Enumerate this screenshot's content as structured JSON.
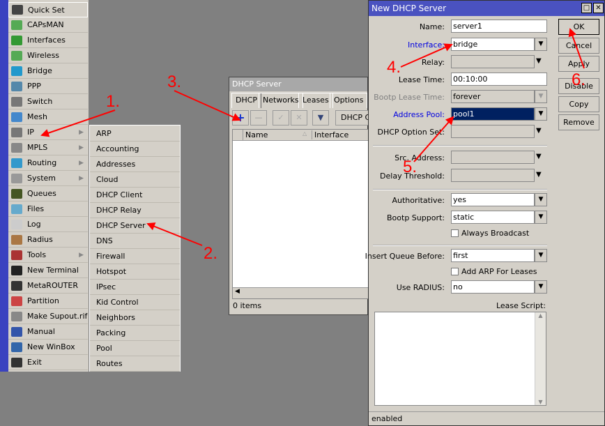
{
  "menu": {
    "items": [
      {
        "label": "Quick Set",
        "icon": "wand-icon",
        "color": "#444"
      },
      {
        "label": "CAPsMAN",
        "icon": "antenna-icon",
        "color": "#5a5"
      },
      {
        "label": "Interfaces",
        "icon": "nic-icon",
        "color": "#393"
      },
      {
        "label": "Wireless",
        "icon": "antenna-icon",
        "color": "#5a5"
      },
      {
        "label": "Bridge",
        "icon": "bridge-icon",
        "color": "#29c"
      },
      {
        "label": "PPP",
        "icon": "ppp-icon",
        "color": "#58a"
      },
      {
        "label": "Switch",
        "icon": "switch-icon",
        "color": "#777"
      },
      {
        "label": "Mesh",
        "icon": "mesh-icon",
        "color": "#48c"
      },
      {
        "label": "IP",
        "icon": "ip-icon",
        "color": "#777",
        "submenu": true
      },
      {
        "label": "MPLS",
        "icon": "mpls-icon",
        "color": "#888",
        "submenu": true
      },
      {
        "label": "Routing",
        "icon": "routing-icon",
        "color": "#39c",
        "submenu": true
      },
      {
        "label": "System",
        "icon": "gear-icon",
        "color": "#999",
        "submenu": true
      },
      {
        "label": "Queues",
        "icon": "queues-icon",
        "color": "#452"
      },
      {
        "label": "Files",
        "icon": "folder-icon",
        "color": "#6ac"
      },
      {
        "label": "Log",
        "icon": "log-icon",
        "color": "#ccc"
      },
      {
        "label": "Radius",
        "icon": "radius-icon",
        "color": "#a74"
      },
      {
        "label": "Tools",
        "icon": "tools-icon",
        "color": "#a33",
        "submenu": true
      },
      {
        "label": "New Terminal",
        "icon": "terminal-icon",
        "color": "#222"
      },
      {
        "label": "MetaROUTER",
        "icon": "metarouter-icon",
        "color": "#333"
      },
      {
        "label": "Partition",
        "icon": "partition-icon",
        "color": "#c44"
      },
      {
        "label": "Make Supout.rif",
        "icon": "supout-icon",
        "color": "#888"
      },
      {
        "label": "Manual",
        "icon": "help-icon",
        "color": "#35a"
      },
      {
        "label": "New WinBox",
        "icon": "winbox-icon",
        "color": "#36a"
      },
      {
        "label": "Exit",
        "icon": "exit-icon",
        "color": "#333"
      }
    ]
  },
  "submenu": {
    "items": [
      "ARP",
      "Accounting",
      "Addresses",
      "Cloud",
      "DHCP Client",
      "DHCP Relay",
      "DHCP Server",
      "DNS",
      "Firewall",
      "Hotspot",
      "IPsec",
      "Kid Control",
      "Neighbors",
      "Packing",
      "Pool",
      "Routes"
    ]
  },
  "dhcp_window": {
    "title": "DHCP Server",
    "tabs": [
      "DHCP",
      "Networks",
      "Leases",
      "Options"
    ],
    "dhcp_config": "DHCP Config",
    "columns": [
      "Name",
      "Interface"
    ],
    "status": "0 items"
  },
  "dialog": {
    "title": "New DHCP Server",
    "fields": {
      "name": {
        "label": "Name:",
        "value": "server1"
      },
      "interface": {
        "label": "Interface:",
        "value": "bridge"
      },
      "relay": {
        "label": "Relay:",
        "value": ""
      },
      "lease_time": {
        "label": "Lease Time:",
        "value": "00:10:00"
      },
      "bootp_lease_time": {
        "label": "Bootp Lease Time:",
        "value": "forever"
      },
      "address_pool": {
        "label": "Address Pool:",
        "value": "pool1"
      },
      "dhcp_option_set": {
        "label": "DHCP Option Set:",
        "value": ""
      },
      "src_address": {
        "label": "Src. Address:",
        "value": ""
      },
      "delay_threshold": {
        "label": "Delay Threshold:",
        "value": ""
      },
      "authoritative": {
        "label": "Authoritative:",
        "value": "yes"
      },
      "bootp_support": {
        "label": "Bootp Support:",
        "value": "static"
      },
      "always_broadcast": {
        "label": "Always Broadcast"
      },
      "insert_queue_before": {
        "label": "Insert Queue Before:",
        "value": "first"
      },
      "add_arp": {
        "label": "Add ARP For Leases"
      },
      "use_radius": {
        "label": "Use RADIUS:",
        "value": "no"
      },
      "lease_script": {
        "label": "Lease Script:"
      }
    },
    "buttons": {
      "ok": "OK",
      "cancel": "Cancel",
      "apply": "Apply",
      "disable": "Disable",
      "copy": "Copy",
      "remove": "Remove"
    },
    "status": "enabled"
  },
  "annotations": [
    "1.",
    "2.",
    "3.",
    "4.",
    "5.",
    "6."
  ],
  "accent": "#ff0000"
}
